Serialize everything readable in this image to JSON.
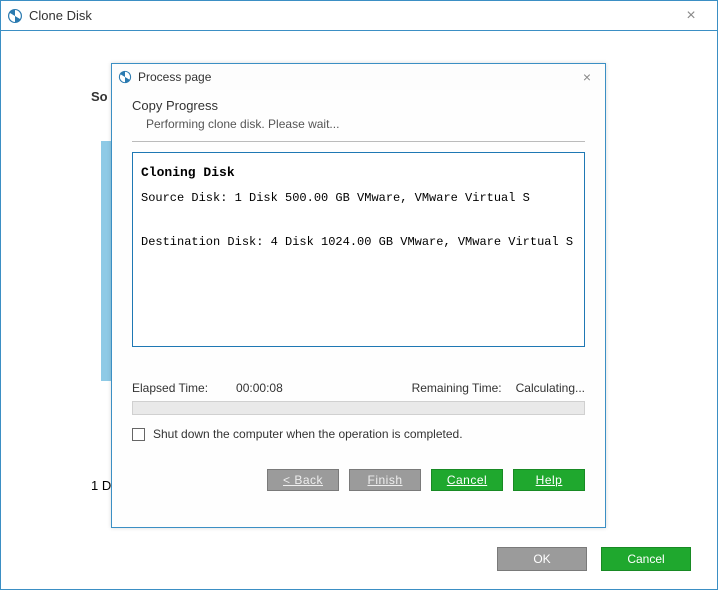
{
  "outer": {
    "title": "Clone Disk",
    "bg_label_fragment": "So",
    "one_d": "1 D",
    "ok": "OK",
    "cancel": "Cancel"
  },
  "modal": {
    "title": "Process page",
    "heading": "Copy Progress",
    "subheading": "Performing clone disk. Please wait...",
    "log": {
      "title": "Cloning Disk",
      "source_line": "Source Disk: 1 Disk 500.00 GB VMware, VMware Virtual S",
      "dest_line": "Destination Disk: 4 Disk 1024.00 GB VMware, VMware Virtual S"
    },
    "elapsed_label": "Elapsed Time:",
    "elapsed_value": "00:00:08",
    "remaining_label": "Remaining Time:",
    "remaining_value": "Calculating...",
    "shutdown_label": "Shut down the computer when the operation is completed.",
    "buttons": {
      "back": "< Back",
      "finish": "Finish",
      "cancel": "Cancel",
      "help": "Help"
    }
  }
}
